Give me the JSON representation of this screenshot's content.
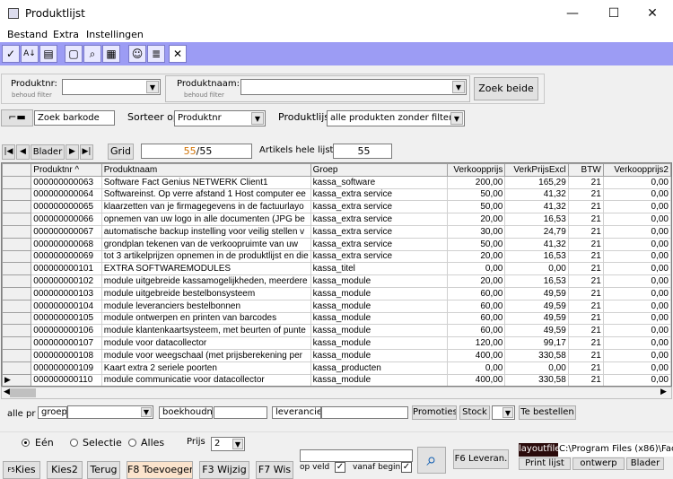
{
  "window": {
    "title": "Produktlijst",
    "minimize": "—",
    "maximize": "☐",
    "close": "✕"
  },
  "menu": [
    "Bestand",
    "Extra",
    "Instellingen"
  ],
  "toolbar_icons": [
    "✓",
    "A↓",
    "▤",
    "▢",
    "⌕",
    "▦",
    "☺",
    "≣",
    "✕"
  ],
  "filter": {
    "produktnr_label": "Produktnr:",
    "produktnr_sub": "behoud filter",
    "produktnaam_label": "Produktnaam:",
    "produktnaam_sub": "behoud filter",
    "zoek_beide": "Zoek beide"
  },
  "barcode": {
    "label": "Zoek barkode",
    "sorteer_op_label": "Sorteer op",
    "sorteer_op_value": "Produktnr",
    "produktlijst_label": "Produktlijst",
    "produktlijst_value": "alle produkten zonder filter"
  },
  "nav": {
    "blader": "Blader",
    "grid": "Grid",
    "count_a": "55",
    "count_b": "/55",
    "artikels_label": "Artikels hele lijst:",
    "artikels_value": "55"
  },
  "columns": [
    "Produktnr ^",
    "Produktnaam",
    "Groep",
    "Verkoopprijs",
    "VerkPrijsExcl",
    "BTW",
    "Verkoopprijs2"
  ],
  "rows": [
    [
      "000000000063",
      "Software Fact Genius NETWERK Client1",
      "kassa_software",
      "200,00",
      "165,29",
      "21",
      "0,00"
    ],
    [
      "000000000064",
      "Softwareinst. Op verre afstand 1 Host computer ee",
      "kassa_extra service",
      "50,00",
      "41,32",
      "21",
      "0,00"
    ],
    [
      "000000000065",
      "klaarzetten van je firmagegevens in de factuurlayo",
      "kassa_extra service",
      "50,00",
      "41,32",
      "21",
      "0,00"
    ],
    [
      "000000000066",
      "opnemen van uw logo in alle documenten (JPG be",
      "kassa_extra service",
      "20,00",
      "16,53",
      "21",
      "0,00"
    ],
    [
      "000000000067",
      "automatische backup instelling voor veilig stellen v",
      "kassa_extra service",
      "30,00",
      "24,79",
      "21",
      "0,00"
    ],
    [
      "000000000068",
      "grondplan tekenen van de verkoopruimte van uw",
      "kassa_extra service",
      "50,00",
      "41,32",
      "21",
      "0,00"
    ],
    [
      "000000000069",
      "tot 3 artikelprijzen opnemen in de produktlijst en die",
      "kassa_extra service",
      "20,00",
      "16,53",
      "21",
      "0,00"
    ],
    [
      "000000000101",
      "EXTRA SOFTWAREMODULES",
      "kassa_titel",
      "0,00",
      "0,00",
      "21",
      "0,00"
    ],
    [
      "000000000102",
      "module uitgebreide kassamogelijkheden, meerdere",
      "kassa_module",
      "20,00",
      "16,53",
      "21",
      "0,00"
    ],
    [
      "000000000103",
      "module uitgebreide bestelbonsysteem",
      "kassa_module",
      "60,00",
      "49,59",
      "21",
      "0,00"
    ],
    [
      "000000000104",
      "module leveranciers bestelbonnen",
      "kassa_module",
      "60,00",
      "49,59",
      "21",
      "0,00"
    ],
    [
      "000000000105",
      "module ontwerpen en printen van barcodes",
      "kassa_module",
      "60,00",
      "49,59",
      "21",
      "0,00"
    ],
    [
      "000000000106",
      "module klantenkaartsysteem, met beurten of punte",
      "kassa_module",
      "60,00",
      "49,59",
      "21",
      "0,00"
    ],
    [
      "000000000107",
      "module voor datacollector",
      "kassa_module",
      "120,00",
      "99,17",
      "21",
      "0,00"
    ],
    [
      "000000000108",
      "module voor weegschaal (met prijsberekening per",
      "kassa_module",
      "400,00",
      "330,58",
      "21",
      "0,00"
    ],
    [
      "000000000109",
      "Kaart extra 2 seriele poorten",
      "kassa_producten",
      "0,00",
      "0,00",
      "21",
      "0,00"
    ],
    [
      "000000000110",
      "module  communicatie voor datacollector",
      "kassa_module",
      "400,00",
      "330,58",
      "21",
      "0,00"
    ]
  ],
  "filterbar": {
    "alle_pr": "alle pr",
    "groep": "groep",
    "boekhoudnr": "boekhoudnr",
    "leverancier": "leverancier",
    "promoties": "Promoties",
    "stock": "Stock",
    "te_bestellen": "Te bestellen"
  },
  "bottom": {
    "een": "Eén",
    "selectie": "Selectie",
    "alles": "Alles",
    "prijs_label": "Prijs",
    "prijs_value": "2",
    "f6": "F6 Leveran.",
    "layoutfile": "layoutfile",
    "path": "C:\\Program Files (x86)\\Fac",
    "print_lijst": "Print lijst",
    "ontwerp": "ontwerp",
    "blader": "Blader",
    "op_veld": "op veld",
    "vanaf_begin": "vanaf begin"
  },
  "fkeys": {
    "f5": "Kies",
    "kies2": "Kies2",
    "terug": "Terug",
    "f8": "F8 Toevoegen",
    "f3": "F3 Wijzig",
    "f7": "F7 Wis",
    "f5_small": "F5"
  },
  "colors": {
    "toolbar": "#9c9cf4",
    "f8_bg": "#fbe3cc",
    "layoutfile_bg": "#2a0a0a",
    "count_orange": "#d07000"
  }
}
